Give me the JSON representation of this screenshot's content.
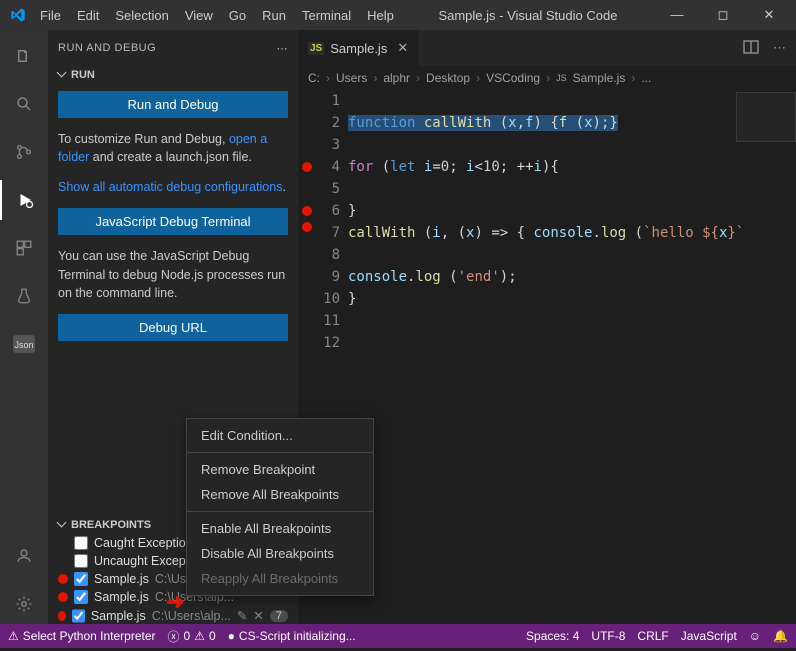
{
  "titlebar": {
    "menus": [
      "File",
      "Edit",
      "Selection",
      "View",
      "Go",
      "Run",
      "Terminal",
      "Help"
    ],
    "title": "Sample.js - Visual Studio Code"
  },
  "sidebar": {
    "header": "RUN AND DEBUG",
    "run_section": "RUN",
    "run_and_debug": "Run and Debug",
    "customize_prefix": "To customize Run and Debug, ",
    "open_folder": "open a folder",
    "customize_mid": " and create a launch.json file.",
    "show_all": "Show all automatic debug configurations",
    "js_terminal": "JavaScript Debug Terminal",
    "js_para": "You can use the JavaScript Debug Terminal to debug Node.js processes run on the command line.",
    "debug_url": "Debug URL",
    "breakpoints_section": "BREAKPOINTS",
    "caught": "Caught Exceptions",
    "uncaught": "Uncaught Exceptions",
    "bp_items": [
      {
        "file": "Sample.js",
        "path": "C:\\Users\\alp..."
      },
      {
        "file": "Sample.js",
        "path": "C:\\Users\\alp..."
      },
      {
        "file": "Sample.js",
        "path": "C:\\Users\\alp..."
      }
    ],
    "bp_badge": "7"
  },
  "editor": {
    "tab_label": "Sample.js",
    "crumbs": [
      "C:",
      "Users",
      "alphr",
      "Desktop",
      "VSCoding",
      "Sample.js",
      "..."
    ],
    "lines": [
      "1",
      "2",
      "3",
      "4",
      "5",
      "6",
      "7",
      "8",
      "9",
      "10",
      "11",
      "12"
    ]
  },
  "code": {
    "l2a": "function",
    "l2b": " callWith ",
    "l2c": "(",
    "l2d": "x",
    "l2e": ",",
    "l2f": "f",
    "l2g": ") {",
    "l2h": "f",
    "l2i": " (",
    "l2j": "x",
    "l2k": ");}",
    "l4a": "for",
    "l4b": " (",
    "l4c": "let",
    "l4d": " i",
    "l4e": "=",
    "l4f": "0",
    "l4g": "; ",
    "l4h": "i",
    "l4i": "<",
    "l4j": "10",
    "l4k": "; ++",
    "l4l": "i",
    "l4m": "){",
    "l6a": "}",
    "l7a": "callWith",
    "l7b": " (",
    "l7c": "i",
    "l7d": ", (",
    "l7e": "x",
    "l7f": ") => { ",
    "l7g": "console",
    "l7h": ".",
    "l7i": "log",
    "l7j": " (",
    "l7k": "`hello ${",
    "l7l": "x",
    "l7m": "}`",
    "l9a": "console",
    "l9b": ".",
    "l9c": "log",
    "l9d": " (",
    "l9e": "'end'",
    "l9f": ");",
    "l10a": "}"
  },
  "context_menu": {
    "edit_condition": "Edit Condition...",
    "remove_bp": "Remove Breakpoint",
    "remove_all": "Remove All Breakpoints",
    "enable_all": "Enable All Breakpoints",
    "disable_all": "Disable All Breakpoints",
    "reapply_all": "Reapply All Breakpoints"
  },
  "statusbar": {
    "python": "Select Python Interpreter",
    "errors": "0",
    "warnings": "0",
    "cs": "CS-Script initializing...",
    "spaces": "Spaces: 4",
    "encoding": "UTF-8",
    "eol": "CRLF",
    "lang": "JavaScript"
  }
}
